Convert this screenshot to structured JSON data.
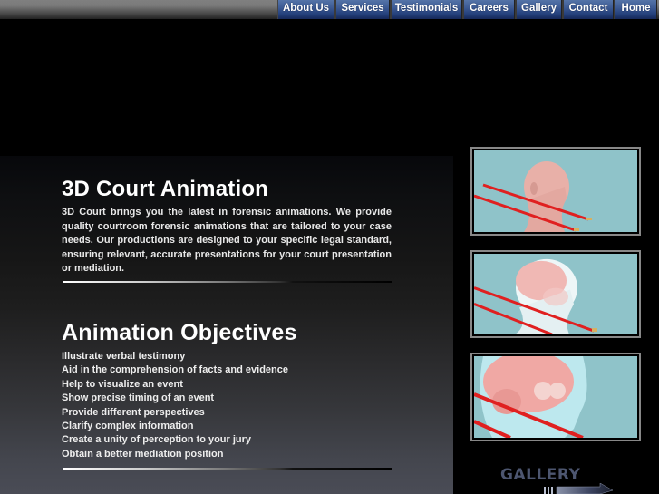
{
  "nav": {
    "items": [
      {
        "label": "About Us"
      },
      {
        "label": "Services"
      },
      {
        "label": "Testimonials"
      },
      {
        "label": "Careers"
      },
      {
        "label": "Gallery"
      },
      {
        "label": "Contact"
      },
      {
        "label": "Home"
      }
    ]
  },
  "main": {
    "title": "3D Court Animation",
    "intro": "3D Court brings you the latest in forensic animations. We provide quality courtroom forensic animations that are tailored to your case needs. Our productions are designed to your specific legal standard, ensuring relevant, accurate presentations for your court presentation or mediation.",
    "objectives_title": "Animation Objectives",
    "objectives": [
      "Illustrate verbal testimony",
      "Aid in the comprehension of facts and evidence",
      "Help to visualize an event",
      "Show precise timing of an event",
      "Provide different perspectives",
      "Clarify complex information",
      "Create a unity of perception to your jury",
      "Obtain a better mediation position"
    ]
  },
  "sidebar": {
    "thumbnails": [
      {
        "subject": "head-trajectory-exterior"
      },
      {
        "subject": "head-trajectory-translucent-skull"
      },
      {
        "subject": "head-trajectory-brain-cutaway"
      }
    ],
    "gallery_label": "GALLERY",
    "gallery_icon": "arrow-right-icon"
  },
  "colors": {
    "nav_blue": "#2c4a86",
    "thumb_bg": "#8fc3c9",
    "trajectory_red": "#e02020",
    "gallery_text": "#4d5670"
  }
}
